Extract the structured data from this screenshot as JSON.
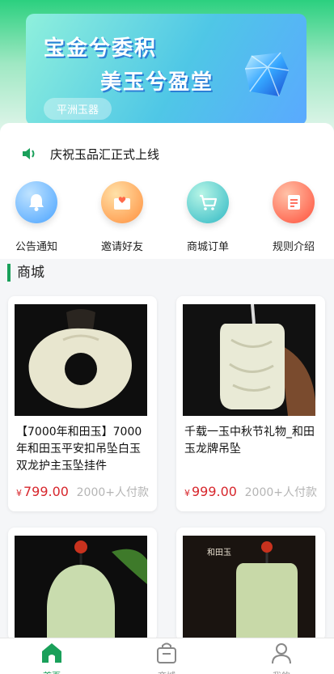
{
  "banner": {
    "line1": "宝金兮委积",
    "line2": "美玉兮盈堂",
    "tag": "平洲玉器"
  },
  "notice": {
    "icon": "speaker-icon",
    "text": "庆祝玉品汇正式上线"
  },
  "menu": [
    {
      "label": "公告通知",
      "icon": "bell-icon",
      "color": "#4aa3ff"
    },
    {
      "label": "邀请好友",
      "icon": "envelope-heart-icon",
      "color": "#ff9b3d"
    },
    {
      "label": "商城订单",
      "icon": "cart-icon",
      "color": "#2fc4b4"
    },
    {
      "label": "规则介绍",
      "icon": "document-icon",
      "color": "#ff5f4a"
    }
  ],
  "section": {
    "title": "商城"
  },
  "products": [
    {
      "title": "【7000年和田玉】7000年和田玉平安扣吊坠白玉双龙护主玉坠挂件",
      "currency": "¥",
      "price": "799.00",
      "sold": "2000+人付款"
    },
    {
      "title": "千载一玉中秋节礼物_和田玉龙牌吊坠",
      "currency": "¥",
      "price": "999.00",
      "sold": "2000+人付款"
    },
    {
      "title": "",
      "currency": "",
      "price": "",
      "sold": ""
    },
    {
      "title": "",
      "currency": "",
      "price": "",
      "sold": "",
      "image_text": "和田玉"
    }
  ],
  "tabbar": [
    {
      "label": "首页",
      "icon": "home-icon",
      "active": true
    },
    {
      "label": "商城",
      "icon": "shop-bag-icon",
      "active": false
    },
    {
      "label": "我的",
      "icon": "user-icon",
      "active": false
    }
  ],
  "colors": {
    "accent": "#1aa05a",
    "price": "#d7262c"
  }
}
